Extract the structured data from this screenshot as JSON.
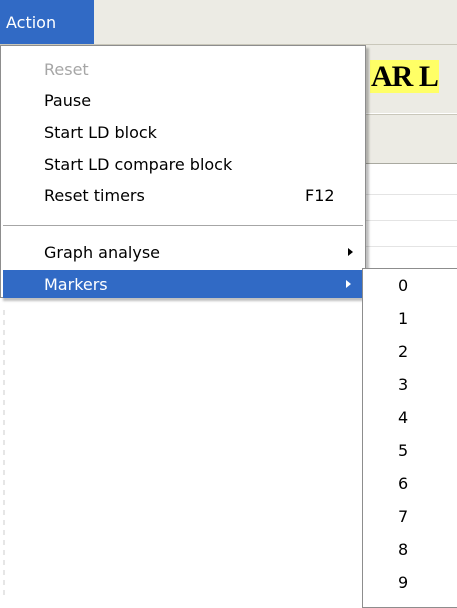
{
  "menubar": {
    "action_label": "Action"
  },
  "background": {
    "title_fragment": "AR L"
  },
  "menu": {
    "items": [
      {
        "label": "Reset",
        "shortcut": "",
        "disabled": true
      },
      {
        "label": "Pause",
        "shortcut": ""
      },
      {
        "label": "Start LD block",
        "shortcut": ""
      },
      {
        "label": "Start LD compare block",
        "shortcut": ""
      },
      {
        "label": "Reset timers",
        "shortcut": "F12"
      },
      {
        "label": "Graph analyse",
        "shortcut": "",
        "submenu": true
      },
      {
        "label": "Markers",
        "shortcut": "",
        "submenu": true,
        "selected": true
      }
    ]
  },
  "markers_submenu": {
    "items": [
      "0",
      "1",
      "2",
      "3",
      "4",
      "5",
      "6",
      "7",
      "8",
      "9"
    ]
  },
  "colors": {
    "highlight": "#316ac5",
    "menubar": "#ecebe4",
    "disabled": "#a6a6a6"
  }
}
